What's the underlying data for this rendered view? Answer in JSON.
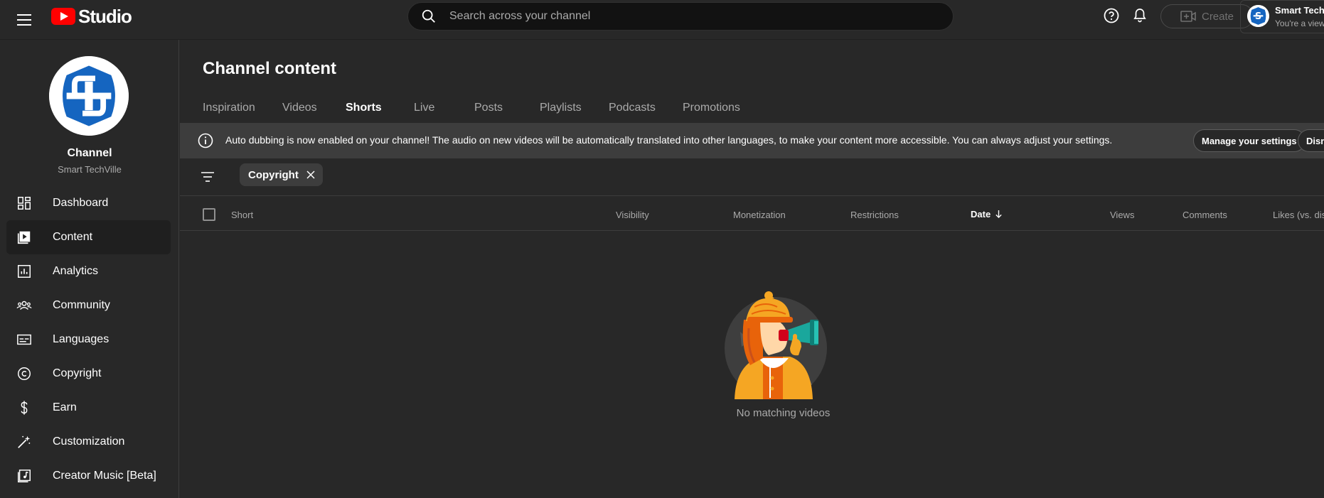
{
  "app": {
    "logo_text": "Studio"
  },
  "search": {
    "placeholder": "Search across your channel"
  },
  "header": {
    "create_label": "Create",
    "account_name": "Smart TechVille",
    "account_sub": "You're a viewer"
  },
  "sidebar": {
    "channel_label": "Channel",
    "channel_name": "Smart TechVille",
    "items": [
      {
        "label": "Dashboard",
        "icon": "dashboard-icon"
      },
      {
        "label": "Content",
        "icon": "content-icon"
      },
      {
        "label": "Analytics",
        "icon": "analytics-icon"
      },
      {
        "label": "Community",
        "icon": "community-icon"
      },
      {
        "label": "Languages",
        "icon": "languages-icon"
      },
      {
        "label": "Copyright",
        "icon": "copyright-icon"
      },
      {
        "label": "Earn",
        "icon": "earn-icon"
      },
      {
        "label": "Customization",
        "icon": "customization-icon"
      },
      {
        "label": "Creator Music [Beta]",
        "icon": "music-icon"
      }
    ],
    "active_item": "Content"
  },
  "main": {
    "title": "Channel content",
    "tabs": [
      {
        "label": "Inspiration"
      },
      {
        "label": "Videos"
      },
      {
        "label": "Shorts"
      },
      {
        "label": "Live"
      },
      {
        "label": "Posts"
      },
      {
        "label": "Playlists"
      },
      {
        "label": "Podcasts"
      },
      {
        "label": "Promotions"
      }
    ],
    "active_tab": "Shorts",
    "banner": {
      "text": "Auto dubbing is now enabled on your channel! The audio on new videos will be automatically translated into other languages, to make your content more accessible. You can always adjust your settings.",
      "manage_label": "Manage your settings",
      "dismiss_label": "Dismiss"
    },
    "filter_chip": "Copyright",
    "columns": {
      "short": "Short",
      "visibility": "Visibility",
      "monetization": "Monetization",
      "restrictions": "Restrictions",
      "date": "Date",
      "views": "Views",
      "comments": "Comments",
      "likes": "Likes (vs. dislikes)"
    },
    "empty_text": "No matching videos"
  },
  "colors": {
    "background": "#282828",
    "brand_red": "#ff0000",
    "banner_bg": "#3d3d3d"
  }
}
